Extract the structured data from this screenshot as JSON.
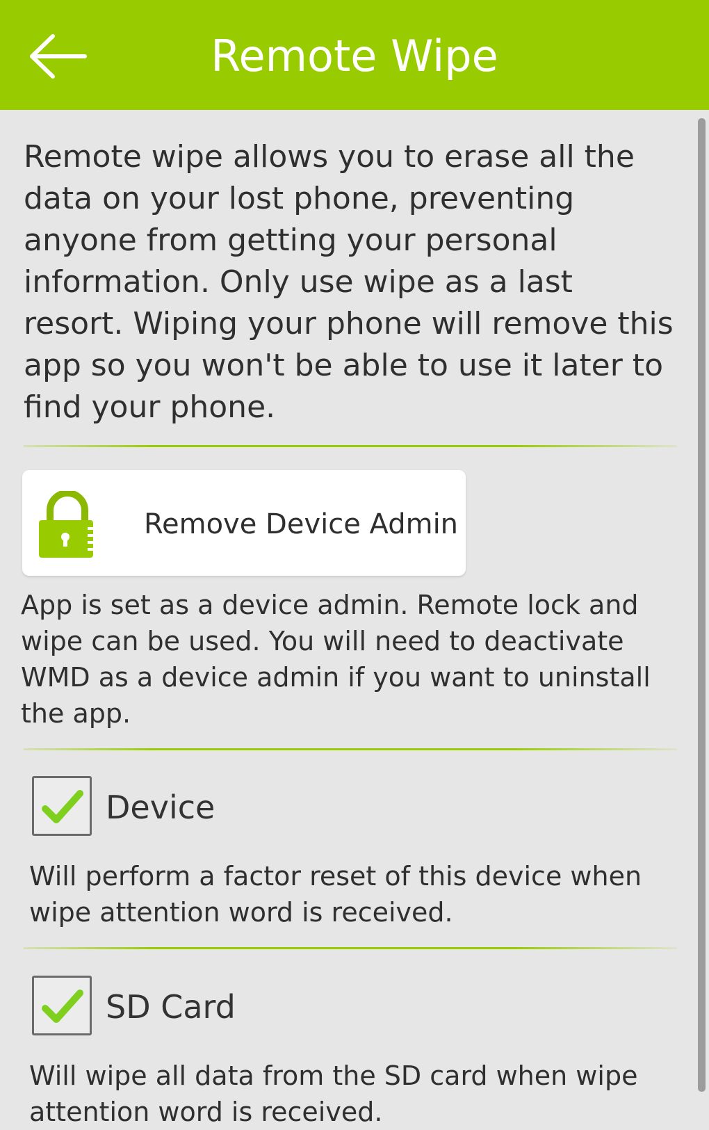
{
  "header": {
    "title": "Remote Wipe",
    "back_icon": "arrow-left-icon",
    "background": "#99cc00"
  },
  "intro": {
    "text": "Remote wipe allows you to erase all the data on your lost phone, preventing anyone from getting your personal information. Only use wipe as a last resort. Wiping your phone will remove this app so you won't be able to use it later to find your phone."
  },
  "device_admin": {
    "button_label": "Remove Device Admin",
    "icon": "lock-icon",
    "description": "App is set as a device admin. Remote lock and wipe can be used. You will need to deactivate WMD as a device admin if you want to uninstall the app."
  },
  "options": [
    {
      "label": "Device",
      "checked": true,
      "description": "Will perform a factor reset of this device when wipe attention word is received."
    },
    {
      "label": "SD Card",
      "checked": true,
      "description": "Will wipe all data from the SD card when wipe attention word is received."
    }
  ],
  "colors": {
    "accent": "#99cc00",
    "background": "#e6e6e6"
  }
}
